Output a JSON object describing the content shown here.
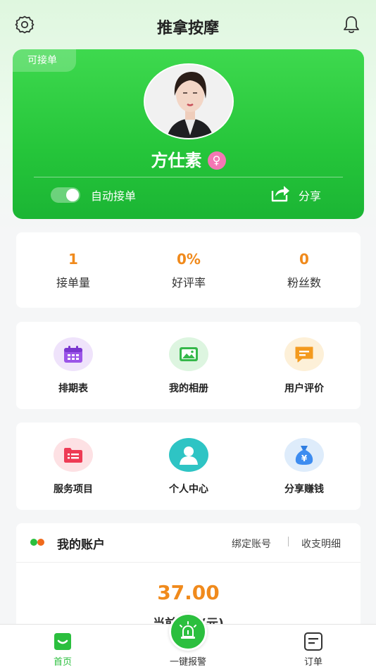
{
  "app": {
    "title": "推拿按摩"
  },
  "profile": {
    "badge": "可接单",
    "name": "方仕素",
    "gender_symbol": "♀",
    "auto_accept_label": "自动接单",
    "auto_accept_on": true,
    "share_label": "分享"
  },
  "stats": [
    {
      "value": "1",
      "label": "接单量"
    },
    {
      "value": "0%",
      "label": "好评率"
    },
    {
      "value": "0",
      "label": "粉丝数"
    }
  ],
  "menu_row1": [
    {
      "label": "排期表",
      "icon": "calendar-icon"
    },
    {
      "label": "我的相册",
      "icon": "photo-album-icon"
    },
    {
      "label": "用户评价",
      "icon": "review-icon"
    }
  ],
  "menu_row2": [
    {
      "label": "服务项目",
      "icon": "service-list-icon"
    },
    {
      "label": "个人中心",
      "icon": "user-center-icon"
    },
    {
      "label": "分享赚钱",
      "icon": "money-bag-icon"
    }
  ],
  "account": {
    "title": "我的账户",
    "bind_label": "绑定账号",
    "details_label": "收支明细",
    "balance": "37.00",
    "balance_label": "当前余额(元)"
  },
  "tabbar": {
    "home": "首页",
    "alarm": "一键报警",
    "orders": "订单"
  },
  "colors": {
    "brand_green": "#2bbf3e",
    "accent_orange": "#f08a1c"
  }
}
